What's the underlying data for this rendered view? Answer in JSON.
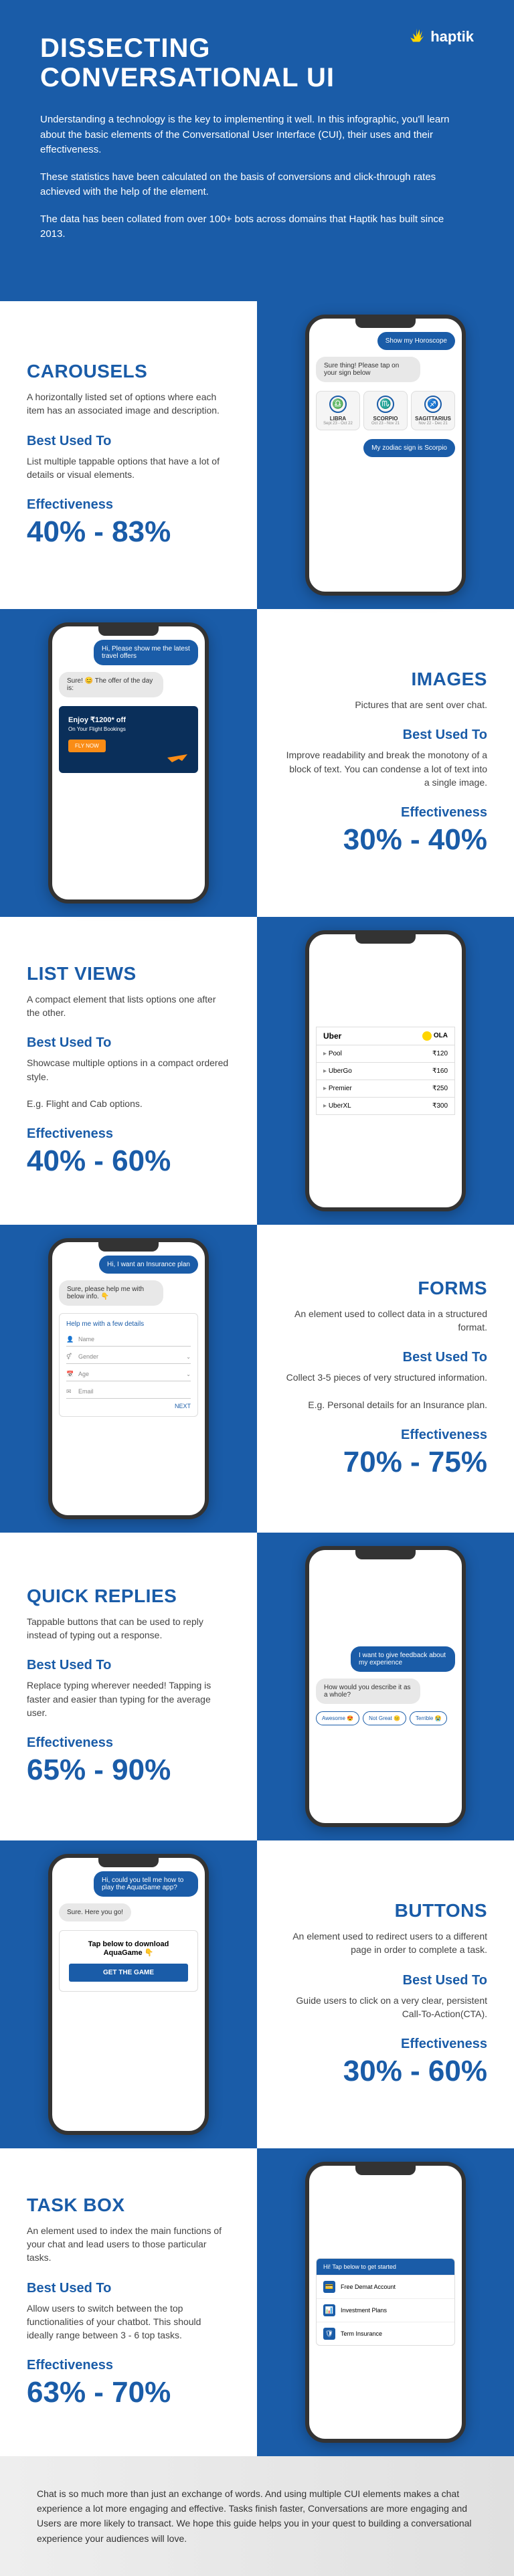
{
  "brand": "haptik",
  "title_l1": "DISSECTING",
  "title_l2": "CONVERSATIONAL UI",
  "intro_p1": "Understanding a technology is the key to implementing it well. In this infographic, you'll learn about the basic elements of the Conversational User Interface (CUI), their uses and their effectiveness.",
  "intro_p2": "These statistics have been calculated on the basis of conversions and click-through rates achieved with the help of the element.",
  "intro_p3": "The data has been collated from over 100+ bots across domains that Haptik has built since 2013.",
  "labels": {
    "best_used": "Best Used To",
    "effectiveness": "Effectiveness"
  },
  "carousels": {
    "title": "CAROUSELS",
    "desc": "A horizontally listed set of options where each item has an associated image and description.",
    "best": "List multiple tappable options that have a lot of details or visual elements.",
    "eff": "40% - 83%",
    "chat1": "Show my Horoscope",
    "chat2": "Sure thing! Please tap on your sign below",
    "chat3": "My zodiac sign is Scorpio",
    "items": [
      {
        "name": "LIBRA",
        "date": "Sept 23 - Oct 22",
        "icon": "♎"
      },
      {
        "name": "SCORPIO",
        "date": "Oct 23 - Nov 21",
        "icon": "♏"
      },
      {
        "name": "SAGITTARIUS",
        "date": "Nov 22 - Dec 21",
        "icon": "♐"
      }
    ]
  },
  "images": {
    "title": "IMAGES",
    "desc": "Pictures that are sent over chat.",
    "best": "Improve readability and break the monotony of a block of text. You can condense a lot of text into a single image.",
    "eff": "30% - 40%",
    "chat1": "Hi, Please show me the latest travel offers",
    "chat2": "Sure! 😊 The offer of the day is:",
    "promo_title": "Enjoy ₹1200* off",
    "promo_sub": "On Your Flight Bookings",
    "promo_btn": "FLY NOW"
  },
  "listviews": {
    "title": "LIST VIEWS",
    "desc": "A compact element that lists options one after the other.",
    "best": "Showcase multiple options in a compact ordered style.",
    "example": "E.g. Flight and Cab options.",
    "eff": "40% - 60%",
    "brand1": "Uber",
    "brand2": "OLA",
    "rows": [
      {
        "name": "Pool",
        "price": "₹120"
      },
      {
        "name": "UberGo",
        "price": "₹160"
      },
      {
        "name": "Premier",
        "price": "₹250"
      },
      {
        "name": "UberXL",
        "price": "₹300"
      }
    ]
  },
  "forms": {
    "title": "FORMS",
    "desc": "An element used to collect data in a structured format.",
    "best": "Collect 3-5 pieces of very structured information.",
    "example": "E.g. Personal details for an Insurance plan.",
    "eff": "70% - 75%",
    "chat1": "Hi, I want an Insurance plan",
    "chat2": "Sure, please help me with below info. 👇",
    "form_title": "Help me with a few details",
    "fields": [
      "Name",
      "Gender",
      "Age",
      "Email"
    ],
    "next": "NEXT"
  },
  "quickreplies": {
    "title": "QUICK REPLIES",
    "desc": "Tappable buttons that can be used to reply instead of typing out a response.",
    "best": "Replace typing wherever needed! Tapping is faster and easier than typing for the average user.",
    "eff": "65% - 90%",
    "chat1": "I want to give feedback about my experience",
    "chat2": "How would you describe it as a whole?",
    "options": [
      "Awesome 😍",
      "Not Great 😐",
      "Terrible 😭"
    ]
  },
  "buttons": {
    "title": "BUTTONS",
    "desc": "An element used to redirect users to a different page in order to complete a task.",
    "best": "Guide users to click on a very clear, persistent Call-To-Action(CTA).",
    "eff": "30% - 60%",
    "chat1": "Hi, could you tell me how to play the AquaGame app?",
    "chat2": "Sure. Here you go!",
    "card_text": "Tap below to download AquaGame 👇",
    "btn": "GET THE GAME"
  },
  "taskbox": {
    "title": "TASK BOX",
    "desc": "An element used to index the main functions of your chat and lead users to those particular tasks.",
    "best": "Allow users to switch between the top functionalities of your chatbot. This should ideally range between 3 - 6 top tasks.",
    "eff": "63% - 70%",
    "header": "Hi! Tap below to get started",
    "rows": [
      "Free Demat Account",
      "Investment Plans",
      "Term Insurance"
    ]
  },
  "footer": "Chat is so much more than just an exchange of words. And using multiple CUI elements makes a chat experience a lot more engaging and effective. Tasks finish faster, Conversations are more engaging and Users are more likely to transact. We hope this guide helps you in your quest to building a conversational experience your audiences will love."
}
